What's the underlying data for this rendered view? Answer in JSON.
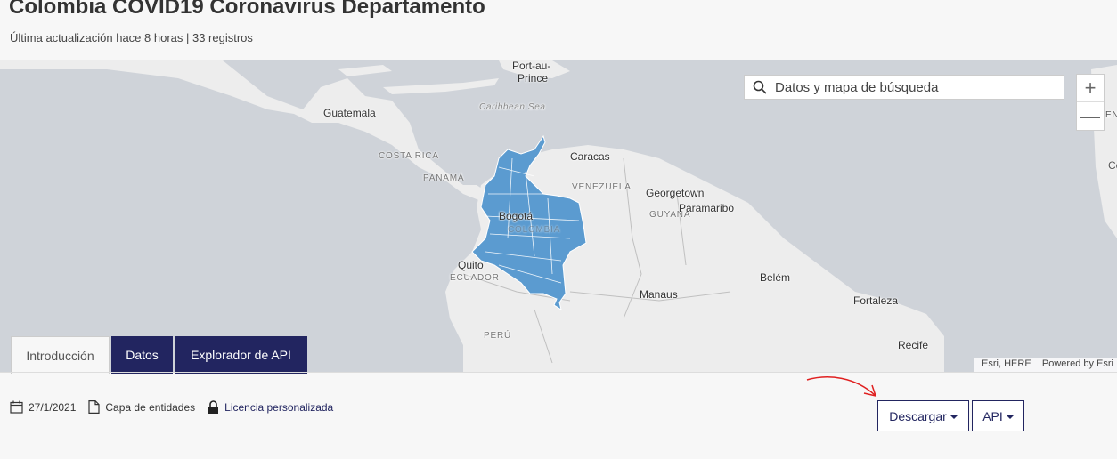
{
  "header": {
    "title": "Colombia COVID19 Coronavirus Departamento",
    "subtitle": "Última actualización hace 8 horas | 33 registros"
  },
  "map": {
    "search_placeholder": "Datos y mapa de búsqueda",
    "zoom_in": "+",
    "zoom_out": "—",
    "attribution_sources": "Esri, HERE",
    "attribution_powered": "Powered by Esri",
    "labels": {
      "port_au_prince_1": "Port-au-",
      "port_au_prince_2": "Prince",
      "guatemala": "Guatemala",
      "caribbean_sea": "Caribbean Sea",
      "costa_rica": "COSTA RICA",
      "panama": "PANAMÁ",
      "caracas": "Caracas",
      "venezuela": "VENEZUELA",
      "georgetown": "Georgetown",
      "guyana": "GUYANA",
      "paramaribo": "Paramaribo",
      "bogota": "Bogotá",
      "colombia": "COLOMBIA",
      "quito": "Quito",
      "ecuador": "ECUADOR",
      "manaus": "Manaus",
      "belem": "Belém",
      "fortaleza": "Fortaleza",
      "peru": "PERÚ",
      "recife": "Recife",
      "edge_right_1": "ENA",
      "edge_right_2": "Co"
    },
    "colors": {
      "water": "#cfd3d9",
      "land": "#ededed",
      "colombia_fill": "#5b9bd0"
    }
  },
  "tabs": [
    {
      "label": "Introducción",
      "active": true
    },
    {
      "label": "Datos",
      "active": false
    },
    {
      "label": "Explorador de API",
      "active": false
    }
  ],
  "meta": {
    "date": "27/1/2021",
    "layer_type": "Capa de entidades",
    "license": "Licencia personalizada"
  },
  "actions": {
    "download_label": "Descargar",
    "api_label": "API"
  },
  "colors": {
    "accent": "#222560",
    "annotation": "#e02020"
  }
}
